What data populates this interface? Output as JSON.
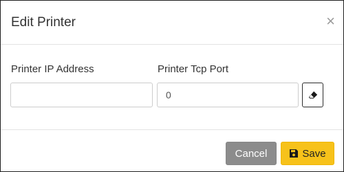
{
  "dialog": {
    "title": "Edit Printer",
    "close_glyph": "×",
    "close_icon": "close-icon"
  },
  "form": {
    "ip_label": "Printer IP Address",
    "ip_value": "",
    "port_label": "Printer Tcp Port",
    "port_value": "0",
    "clear_icon": "eraser-icon"
  },
  "footer": {
    "cancel_label": "Cancel",
    "save_label": "Save",
    "save_icon": "floppy-disk-icon"
  },
  "colors": {
    "cancel_bg": "#8c8c8c",
    "save_bg": "#f7c21a",
    "border": "#cccccc"
  }
}
